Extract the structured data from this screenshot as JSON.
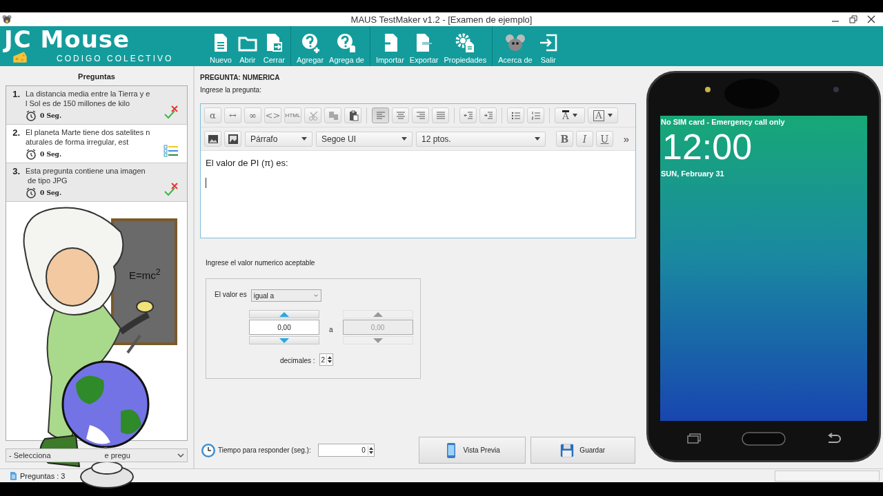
{
  "window": {
    "title": "MAUS TestMaker v1.2 - [Examen de ejemplo]"
  },
  "logo": {
    "title": "JC Mouse",
    "subtitle": "CODIGO COLECTIVO"
  },
  "toolbar": [
    {
      "buttons": [
        {
          "label": "Nuevo"
        },
        {
          "label": "Abrir"
        },
        {
          "label": "Cerrar"
        }
      ]
    },
    {
      "buttons": [
        {
          "label": "Agregar"
        },
        {
          "label": "Agrega de"
        }
      ]
    },
    {
      "buttons": [
        {
          "label": "Importar"
        },
        {
          "label": "Exportar"
        },
        {
          "label": "Propiedades"
        }
      ]
    },
    {
      "buttons": [
        {
          "label": "Acerca de"
        },
        {
          "label": "Salir"
        }
      ]
    }
  ],
  "questions_panel": {
    "title": "Preguntas",
    "items": [
      {
        "number": "1.",
        "lines": [
          "La distancia media entre la Tierra y e",
          "l Sol es de 150 millones de kilo"
        ],
        "time": "0 Seg.",
        "kind": "true_false",
        "selected": false
      },
      {
        "number": "2.",
        "lines": [
          "El planeta Marte tiene dos satelites n",
          "aturales de forma irregular, est"
        ],
        "time": "0 Seg.",
        "kind": "multiple_choice",
        "selected": true
      },
      {
        "number": "3.",
        "lines": [
          "Esta pregunta contiene una imagen",
          " de tipo JPG"
        ],
        "time": "0 Seg.",
        "kind": "true_false",
        "selected": false
      }
    ],
    "type_select": {
      "value_start": "- Selecciona",
      "value_end": "e pregu"
    },
    "board_text": "E=mc$^{2}$"
  },
  "editor": {
    "heading": "PREGUNTA: NUMERICA",
    "prompt": "Ingrese la pregunta:",
    "row1": [
      {
        "buttons": [
          {
            "kind": "text",
            "label": "α",
            "disabled": false
          },
          {
            "kind": "text",
            "label": "↔",
            "disabled": false
          },
          {
            "kind": "text",
            "label": "∞",
            "disabled": false
          },
          {
            "kind": "text",
            "label": "<>",
            "disabled": true
          },
          {
            "kind": "text",
            "label": "HTML",
            "disabled": false
          },
          {
            "kind": "icon",
            "disabled": true
          },
          {
            "kind": "icon",
            "disabled": true
          },
          {
            "kind": "icon",
            "disabled": false
          }
        ]
      },
      {
        "buttons": [
          {
            "kind": "icon",
            "disabled": false,
            "selected": true
          },
          {
            "kind": "icon",
            "disabled": false,
            "selected": false
          },
          {
            "kind": "icon",
            "disabled": false,
            "selected": false
          },
          {
            "kind": "icon",
            "disabled": false,
            "selected": false
          }
        ]
      },
      {
        "buttons": [
          {
            "kind": "icon",
            "disabled": false
          },
          {
            "kind": "icon",
            "disabled": false
          }
        ]
      },
      {
        "buttons": [
          {
            "kind": "icon",
            "disabled": false
          },
          {
            "kind": "icon",
            "disabled": false
          }
        ]
      },
      {
        "buttons": [
          {
            "kind": "color",
            "label": "A",
            "disabled": false
          },
          {
            "kind": "boxed_color",
            "label": "A",
            "disabled": false
          }
        ]
      }
    ],
    "paragraph_select": "Párrafo",
    "font_select": "Segoe UI",
    "size_select": "12 ptos.",
    "style_buttons": [
      {
        "label": "B",
        "kind": "bold"
      },
      {
        "label": "I",
        "kind": "italic"
      },
      {
        "label": "U",
        "kind": "underline"
      }
    ],
    "more": "»",
    "content": "El valor de PI (π) es:"
  },
  "numeric": {
    "prompt": "Ingrese el valor numerico aceptable",
    "value_label": "El valor es",
    "comparison": "igual a",
    "from": {
      "value": "0,00",
      "disabled": false
    },
    "between": "a",
    "to": {
      "value": "0,00",
      "disabled": true
    },
    "decimals_label": "decimales :",
    "decimals": "2"
  },
  "footer": {
    "time_label": "Tiempo para responder (seg.):",
    "time_value": "0",
    "buttons": [
      {
        "label": "Vista Previa"
      },
      {
        "label": "Guardar"
      }
    ]
  },
  "phone": {
    "status": "No SIM card - Emergency call only",
    "time": "12:00",
    "date": "SUN, February 31"
  },
  "status_bar": {
    "text": "Preguntas : 3"
  }
}
